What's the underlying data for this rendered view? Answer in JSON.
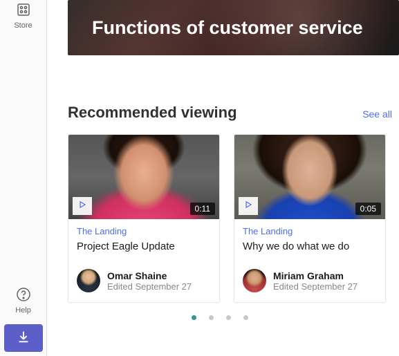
{
  "sidebar": {
    "store_label": "Store",
    "help_label": "Help"
  },
  "hero": {
    "title": "Functions of customer service"
  },
  "section": {
    "title": "Recommended viewing",
    "see_all": "See all"
  },
  "videos": [
    {
      "channel": "The Landing",
      "title": "Project Eagle Update",
      "duration": "0:11",
      "author": "Omar Shaine",
      "edited": "Edited September 27"
    },
    {
      "channel": "The Landing",
      "title": "Why we do what we do",
      "duration": "0:05",
      "author": "Miriam Graham",
      "edited": "Edited September 27"
    }
  ],
  "carousel": {
    "active_index": 0,
    "count": 4
  }
}
